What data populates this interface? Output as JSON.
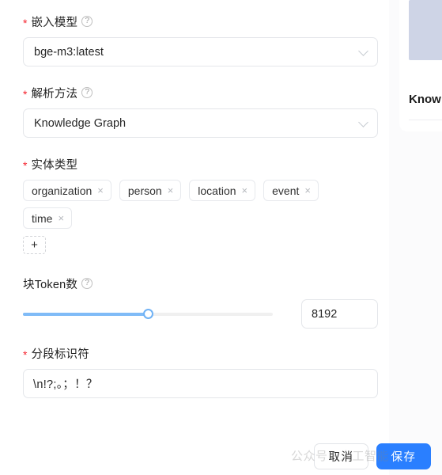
{
  "form": {
    "embedding_model": {
      "label": "嵌入模型",
      "required_marker": "*",
      "help_icon": "question-circle-icon",
      "value": "bge-m3:latest",
      "chevron": "chevron-down-icon"
    },
    "parse_method": {
      "label": "解析方法",
      "required_marker": "*",
      "help_icon": "question-circle-icon",
      "value": "Knowledge Graph",
      "chevron": "chevron-down-icon"
    },
    "entity_types": {
      "label": "实体类型",
      "required_marker": "*",
      "tags": [
        {
          "text": "organization",
          "close": "×"
        },
        {
          "text": "person",
          "close": "×"
        },
        {
          "text": "location",
          "close": "×"
        },
        {
          "text": "event",
          "close": "×"
        },
        {
          "text": "time",
          "close": "×"
        }
      ],
      "add_label": "+"
    },
    "chunk_token_num": {
      "label": "块Token数",
      "help_icon": "question-circle-icon",
      "value": "8192",
      "slider_percent": 50
    },
    "delimiter": {
      "label": "分段标识符",
      "required_marker": "*",
      "value": "\\n!?;。；！？"
    }
  },
  "footer": {
    "cancel_label": "取消",
    "save_label": "保存"
  },
  "right_panel": {
    "card_title": "Know",
    "doc_icon": "document-icon"
  },
  "watermark": {
    "text": "公众号丶人工智能"
  },
  "colors": {
    "accent": "#2a7fff",
    "slider_fill": "#80bbf7",
    "required_star": "#f5222d",
    "border": "#e4e6ea",
    "doc_icon": "#ced4e6"
  }
}
